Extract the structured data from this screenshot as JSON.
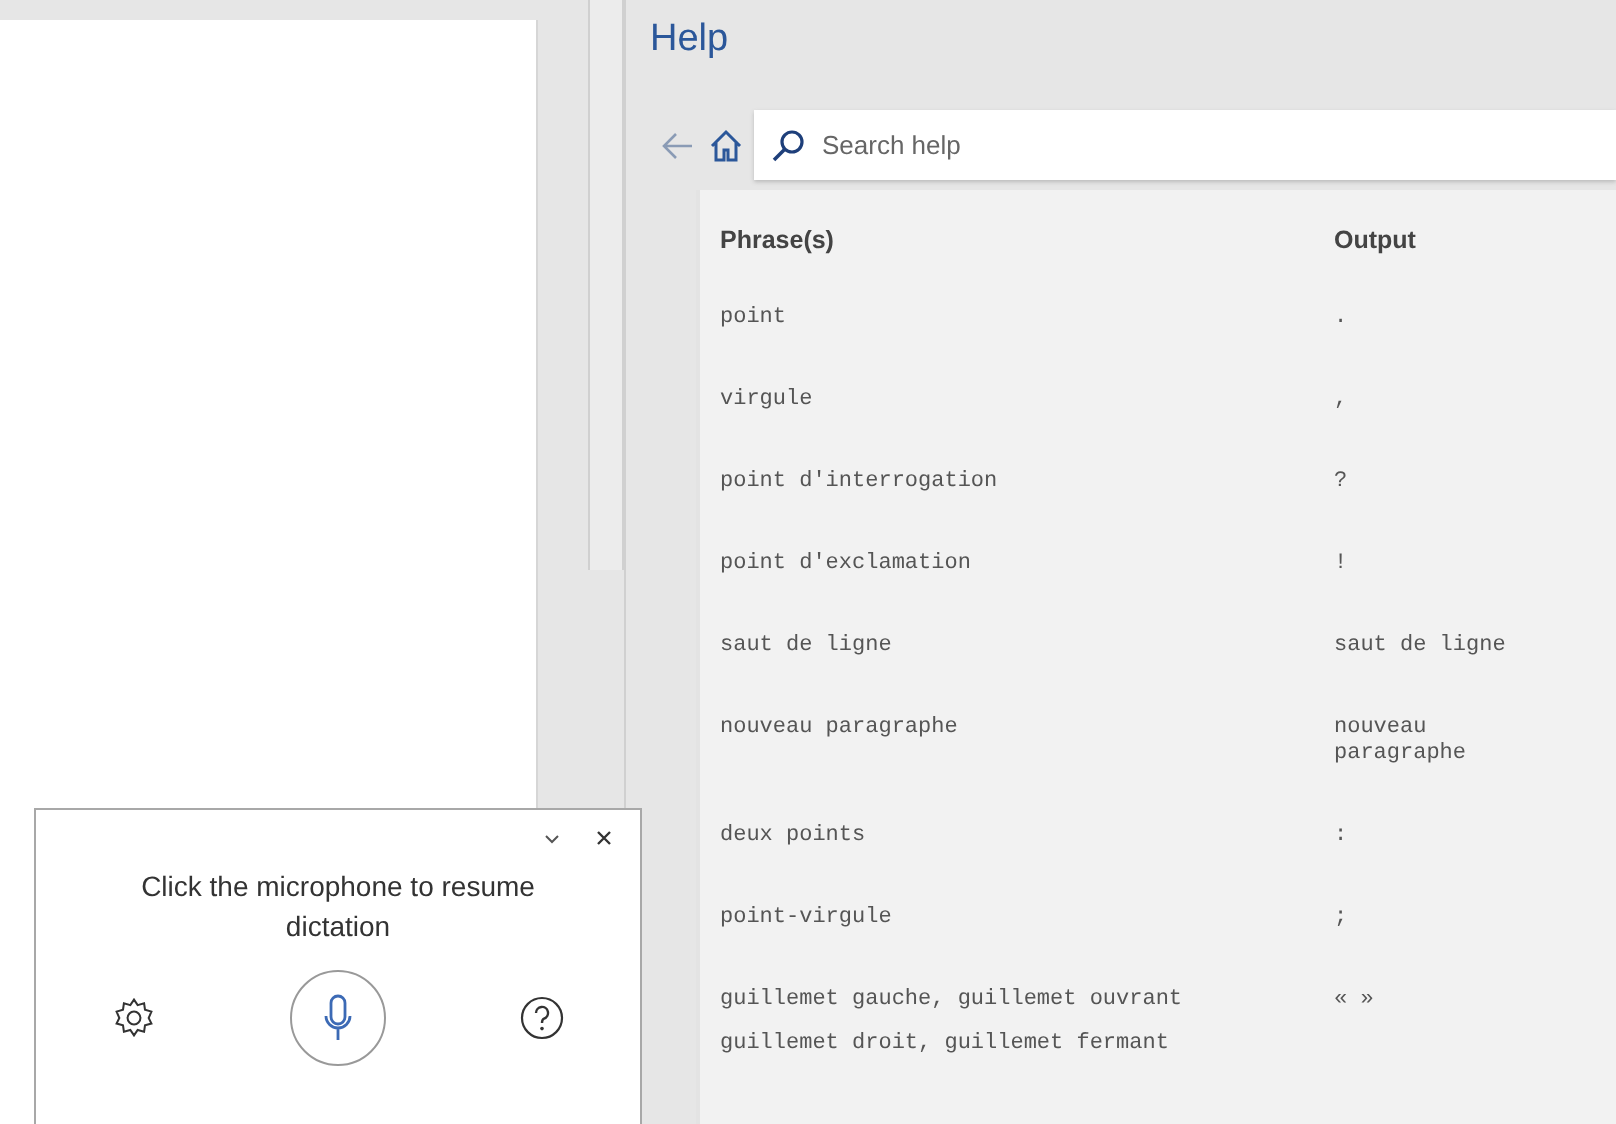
{
  "help": {
    "title": "Help",
    "search": {
      "placeholder": "Search help"
    },
    "table": {
      "columns": [
        "Phrase(s)",
        "Output"
      ],
      "rows": [
        {
          "phrases": [
            "point"
          ],
          "output": "."
        },
        {
          "phrases": [
            "virgule"
          ],
          "output": ","
        },
        {
          "phrases": [
            "point d'interrogation"
          ],
          "output": "?"
        },
        {
          "phrases": [
            "point d'exclamation"
          ],
          "output": "!"
        },
        {
          "phrases": [
            "saut de ligne"
          ],
          "output": "saut de ligne"
        },
        {
          "phrases": [
            "nouveau paragraphe"
          ],
          "output": "nouveau paragraphe"
        },
        {
          "phrases": [
            "deux points"
          ],
          "output": ":"
        },
        {
          "phrases": [
            "point-virgule"
          ],
          "output": ";"
        },
        {
          "phrases": [
            "guillemet gauche, guillemet ouvrant",
            "guillemet droit, guillemet fermant"
          ],
          "output": "« »"
        }
      ]
    }
  },
  "dictation": {
    "message": "Click the microphone to resume dictation"
  }
}
